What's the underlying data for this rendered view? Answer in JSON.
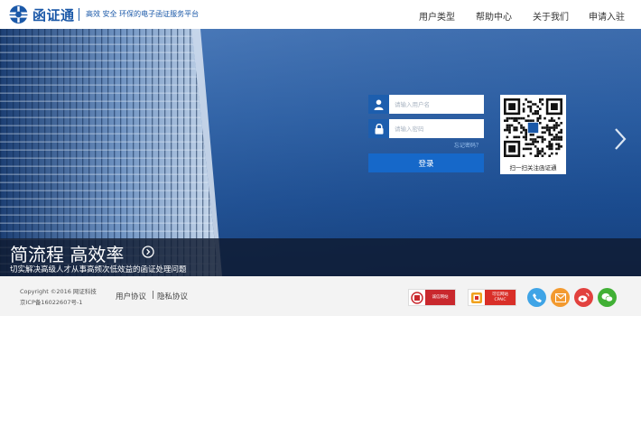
{
  "header": {
    "logo_text": "函证通",
    "tagline": "高效 安全 环保的电子函证服务平台",
    "nav": [
      "用户类型",
      "帮助中心",
      "关于我们",
      "申请入驻"
    ]
  },
  "login": {
    "username_placeholder": "请输入用户名",
    "password_placeholder": "请输入密码",
    "forgot_label": "忘记密码？",
    "submit_label": "登录",
    "qr_caption": "扫一扫关注函证通"
  },
  "hero": {
    "slogan_title": "简流程 高效率",
    "slogan_subtitle": "切实解决高级人才从事高频次低效益的函证处理问题"
  },
  "footer": {
    "copyright_line1": "Copyright ©2016 网证科技",
    "copyright_line2": "京ICP备16022607号-1",
    "user_agreement": "用户协议",
    "separator": "|",
    "privacy_agreement": "隐私协议",
    "badges": [
      {
        "label": "诚信网站",
        "color": "#c9282d"
      },
      {
        "label_line1": "可信网站",
        "label_line2": "CPAIC",
        "color": "#d92f28"
      }
    ],
    "social": [
      {
        "icon": "phone-icon",
        "color": "#3fa4e6"
      },
      {
        "icon": "mail-icon",
        "color": "#f39a2f"
      },
      {
        "icon": "weibo-icon",
        "color": "#e2413e"
      },
      {
        "icon": "wechat-icon",
        "color": "#41b035"
      }
    ]
  },
  "colors": {
    "brand": "#1a58a8",
    "login_button": "#1668c9",
    "hero_blue": "#2a5ea4",
    "footer_bg": "#f3f3f3"
  }
}
